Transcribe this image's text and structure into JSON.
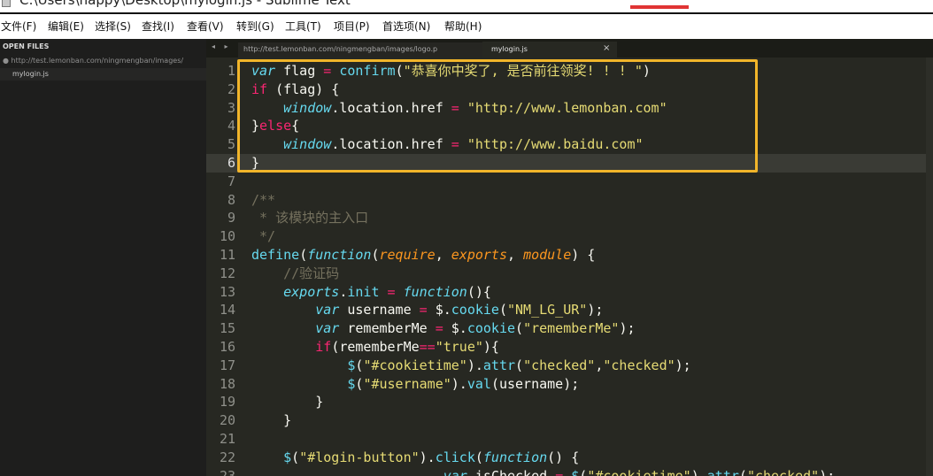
{
  "window": {
    "title": "C:\\Users\\happy\\Desktop\\mylogin.js - Sublime Text"
  },
  "menu": [
    "文件(F)",
    "编辑(E)",
    "选择(S)",
    "查找(I)",
    "查看(V)",
    "转到(G)",
    "工具(T)",
    "项目(P)",
    "首选项(N)",
    "帮助(H)"
  ],
  "sidebar": {
    "header": "OPEN FILES",
    "files": [
      "http://test.lemonban.com/ningmengban/images/",
      "mylogin.js"
    ]
  },
  "tabs": {
    "arrows": "◂ ▸",
    "items": [
      {
        "label": "http://test.lemonban.com/ningmengban/images/logo.p",
        "marker": "●"
      },
      {
        "label": "mylogin.js",
        "marker": "×"
      }
    ]
  },
  "editor": {
    "current_line": 6,
    "highlight_color": "#f1b52a",
    "lines": [
      [
        [
          "it",
          "var"
        ],
        [
          "tx",
          " flag "
        ],
        [
          "kw",
          "="
        ],
        [
          "tx",
          " "
        ],
        [
          "fn",
          "confirm"
        ],
        [
          "tx",
          "("
        ],
        [
          "st",
          "\"恭喜你中奖了, 是否前往领奖! ! ! \""
        ],
        [
          "tx",
          ")"
        ]
      ],
      [
        [
          "kw",
          "if"
        ],
        [
          "tx",
          " (flag) {"
        ]
      ],
      [
        [
          "tx",
          "    "
        ],
        [
          "it",
          "window"
        ],
        [
          "tx",
          ".location.href "
        ],
        [
          "kw",
          "="
        ],
        [
          "tx",
          " "
        ],
        [
          "st",
          "\"http://www.lemonban.com\""
        ]
      ],
      [
        [
          "tx",
          "}"
        ],
        [
          "kw",
          "else"
        ],
        [
          "tx",
          "{"
        ]
      ],
      [
        [
          "tx",
          "    "
        ],
        [
          "it",
          "window"
        ],
        [
          "tx",
          ".location.href "
        ],
        [
          "kw",
          "="
        ],
        [
          "tx",
          " "
        ],
        [
          "st",
          "\"http://www.baidu.com\""
        ]
      ],
      [
        [
          "tx",
          "}"
        ]
      ],
      [],
      [
        [
          "cm",
          "/**"
        ]
      ],
      [
        [
          "cm",
          " * 该模块的主入口"
        ]
      ],
      [
        [
          "cm",
          " */"
        ]
      ],
      [
        [
          "fn",
          "define"
        ],
        [
          "tx",
          "("
        ],
        [
          "it",
          "function"
        ],
        [
          "tx",
          "("
        ],
        [
          "pa",
          "require"
        ],
        [
          "tx",
          ", "
        ],
        [
          "pa",
          "exports"
        ],
        [
          "tx",
          ", "
        ],
        [
          "pa",
          "module"
        ],
        [
          "tx",
          ") {"
        ]
      ],
      [
        [
          "tx",
          "    "
        ],
        [
          "cm",
          "//验证码"
        ]
      ],
      [
        [
          "tx",
          "    "
        ],
        [
          "it",
          "exports"
        ],
        [
          "tx",
          "."
        ],
        [
          "fn",
          "init"
        ],
        [
          "tx",
          " "
        ],
        [
          "kw",
          "="
        ],
        [
          "tx",
          " "
        ],
        [
          "it",
          "function"
        ],
        [
          "tx",
          "(){"
        ]
      ],
      [
        [
          "tx",
          "        "
        ],
        [
          "it",
          "var"
        ],
        [
          "tx",
          " username "
        ],
        [
          "kw",
          "="
        ],
        [
          "tx",
          " $."
        ],
        [
          "fn",
          "cookie"
        ],
        [
          "tx",
          "("
        ],
        [
          "st",
          "\"NM_LG_UR\""
        ],
        [
          "tx",
          ");"
        ]
      ],
      [
        [
          "tx",
          "        "
        ],
        [
          "it",
          "var"
        ],
        [
          "tx",
          " rememberMe "
        ],
        [
          "kw",
          "="
        ],
        [
          "tx",
          " $."
        ],
        [
          "fn",
          "cookie"
        ],
        [
          "tx",
          "("
        ],
        [
          "st",
          "\"rememberMe\""
        ],
        [
          "tx",
          ");"
        ]
      ],
      [
        [
          "tx",
          "        "
        ],
        [
          "kw",
          "if"
        ],
        [
          "tx",
          "(rememberMe"
        ],
        [
          "kw",
          "=="
        ],
        [
          "st",
          "\"true\""
        ],
        [
          "tx",
          "){"
        ]
      ],
      [
        [
          "tx",
          "            "
        ],
        [
          "fn",
          "$"
        ],
        [
          "tx",
          "("
        ],
        [
          "st",
          "\"#cookietime\""
        ],
        [
          "tx",
          ")."
        ],
        [
          "fn",
          "attr"
        ],
        [
          "tx",
          "("
        ],
        [
          "st",
          "\"checked\""
        ],
        [
          "tx",
          ","
        ],
        [
          "st",
          "\"checked\""
        ],
        [
          "tx",
          ");"
        ]
      ],
      [
        [
          "tx",
          "            "
        ],
        [
          "fn",
          "$"
        ],
        [
          "tx",
          "("
        ],
        [
          "st",
          "\"#username\""
        ],
        [
          "tx",
          ")."
        ],
        [
          "fn",
          "val"
        ],
        [
          "tx",
          "(username);"
        ]
      ],
      [
        [
          "tx",
          "        }"
        ]
      ],
      [
        [
          "tx",
          "    }"
        ]
      ],
      [],
      [
        [
          "tx",
          "    "
        ],
        [
          "fn",
          "$"
        ],
        [
          "tx",
          "("
        ],
        [
          "st",
          "\"#login-button\""
        ],
        [
          "tx",
          ")."
        ],
        [
          "fn",
          "click"
        ],
        [
          "tx",
          "("
        ],
        [
          "it",
          "function"
        ],
        [
          "tx",
          "() {"
        ]
      ],
      [
        [
          "tx",
          "                        "
        ],
        [
          "it",
          "var"
        ],
        [
          "tx",
          " isChecked "
        ],
        [
          "kw",
          "="
        ],
        [
          "tx",
          " "
        ],
        [
          "fn",
          "$"
        ],
        [
          "tx",
          "("
        ],
        [
          "st",
          "\"#cookietime\""
        ],
        [
          "tx",
          ")."
        ],
        [
          "fn",
          "attr"
        ],
        [
          "tx",
          "("
        ],
        [
          "st",
          "\"checked\""
        ],
        [
          "tx",
          ");"
        ]
      ]
    ]
  }
}
